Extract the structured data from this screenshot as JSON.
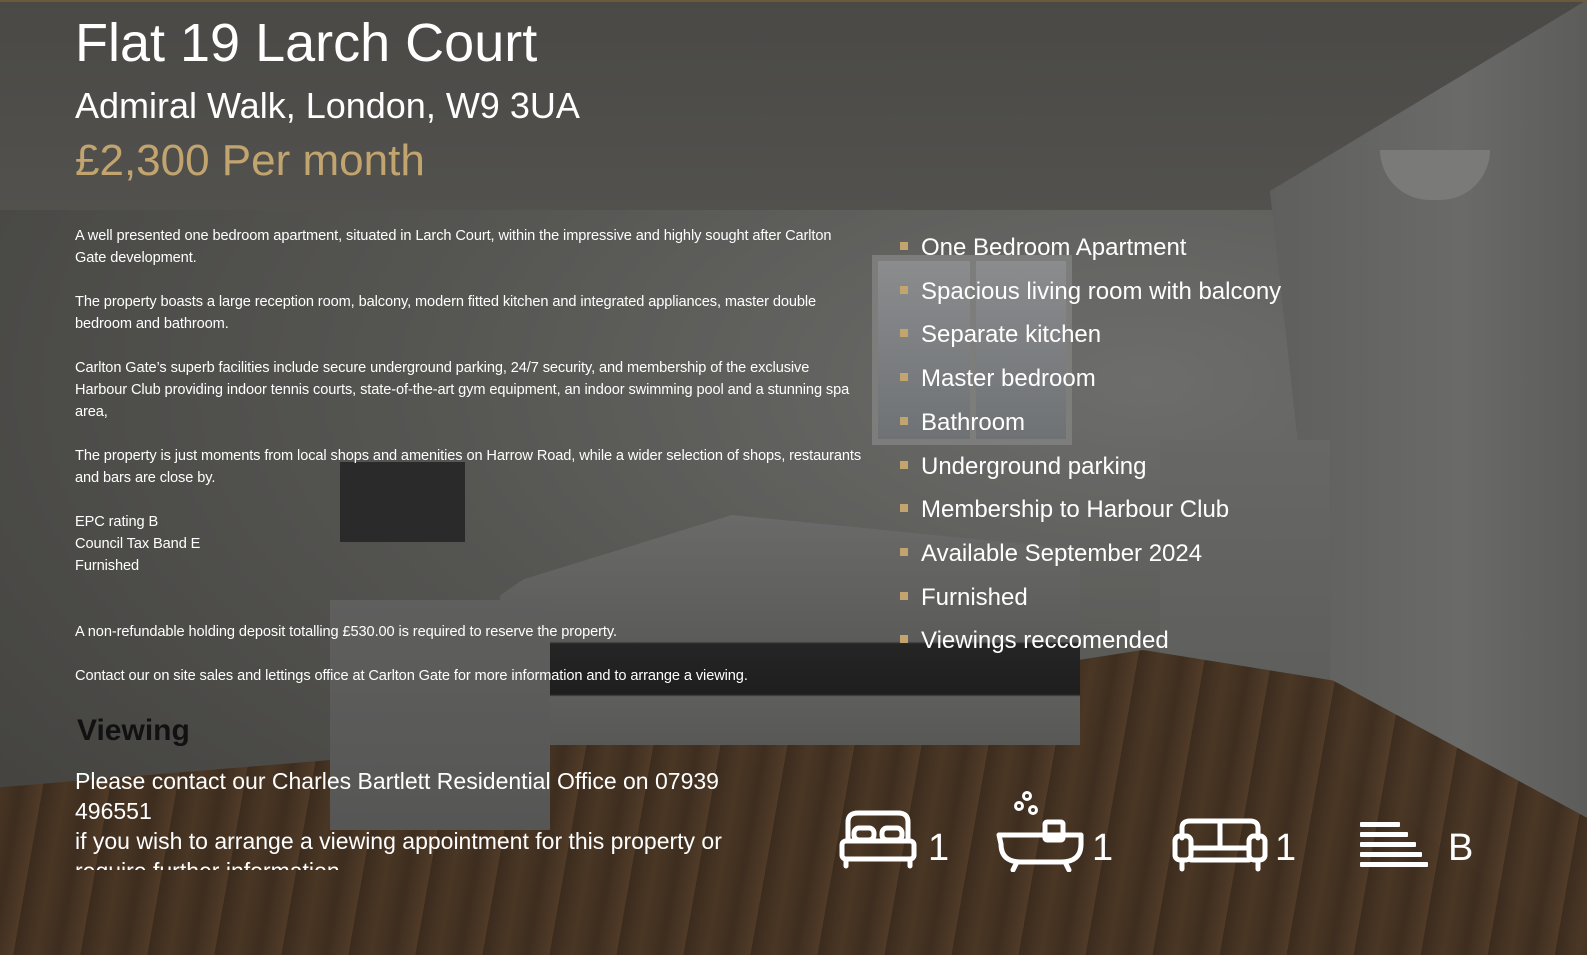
{
  "listing": {
    "title": "Flat 19 Larch Court",
    "address": "Admiral Walk, London, W9 3UA",
    "price": "£2,300 Per month"
  },
  "description": {
    "p1": "A well presented one bedroom apartment, situated in Larch Court, within the impressive and highly sought after Carlton Gate development.",
    "p2": "The property boasts a large reception room, balcony, modern fitted kitchen and integrated appliances, master double bedroom and bathroom.",
    "p3": "Carlton Gate’s superb facilities include secure underground parking, 24/7 security, and membership of the exclusive Harbour Club providing indoor tennis courts, state-of-the-art gym equipment, an indoor swimming pool and a stunning spa area,",
    "p4": "The property is just moments from local shops and amenities on Harrow Road, while a wider selection of shops, restaurants and bars are close by.",
    "epc": "EPC rating B",
    "council_tax": "Council Tax Band E",
    "furnished": "Furnished",
    "deposit": "A non-refundable holding deposit totalling £530.00 is required to reserve the property.",
    "contact": "Contact our on site sales and lettings office at Carlton Gate for more information and to arrange a viewing."
  },
  "viewing": {
    "heading": "Viewing",
    "line1": "Please contact our Charles Bartlett Residential Office on 07939 496551",
    "line2": "if you wish to arrange a viewing appointment for this property or require further information."
  },
  "features": [
    "One Bedroom Apartment",
    "Spacious living room with balcony",
    "Separate kitchen",
    "Master bedroom",
    "Bathroom",
    "Underground parking",
    "Membership to Harbour Club",
    "Available September 2024",
    "Furnished",
    "Viewings reccomended"
  ],
  "stats": {
    "bedrooms": "1",
    "bathrooms": "1",
    "receptions": "1",
    "epc": "B",
    "icons": [
      "bed-icon",
      "bath-icon",
      "sofa-icon",
      "epc-bars-icon"
    ]
  },
  "colors": {
    "price_accent": "#c2a46e",
    "bullet": "#c2a46e",
    "viewing_heading": "#111111"
  }
}
